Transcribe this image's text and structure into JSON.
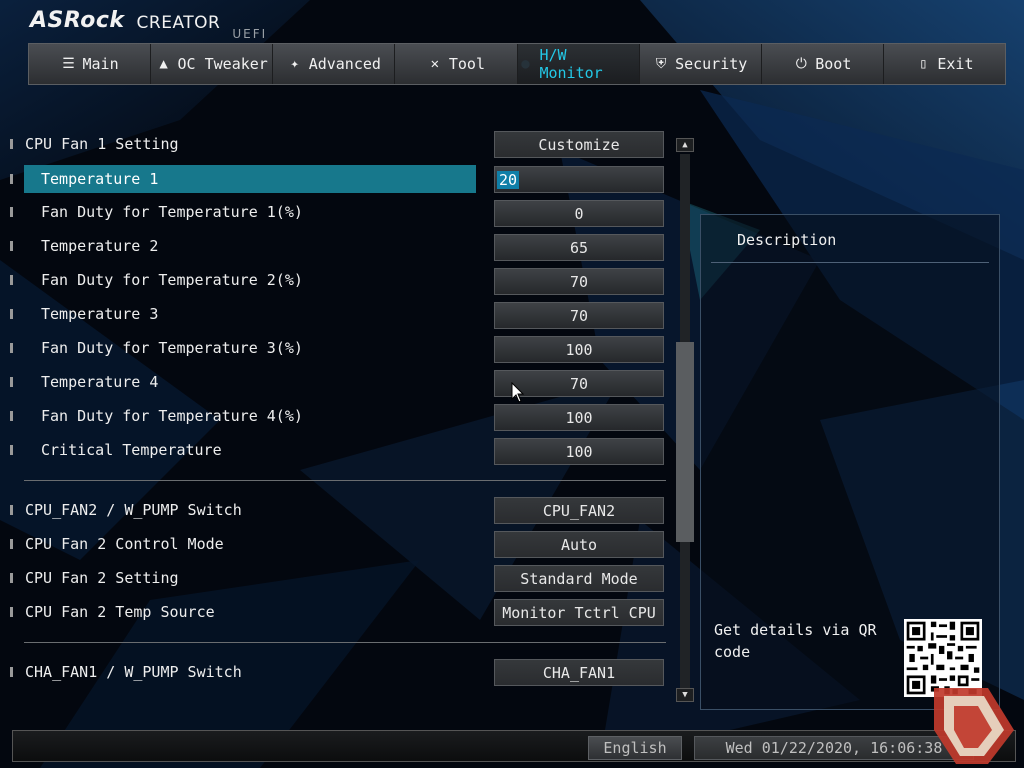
{
  "header": {
    "brand": "ASRock",
    "product": "CREATOR",
    "firmware": "UEFI"
  },
  "tabs": [
    {
      "label": "Main",
      "icon": "list-icon",
      "active": false
    },
    {
      "label": "OC Tweaker",
      "icon": "rocket-icon",
      "active": false
    },
    {
      "label": "Advanced",
      "icon": "star-icon",
      "active": false
    },
    {
      "label": "Tool",
      "icon": "tools-icon",
      "active": false
    },
    {
      "label": "H/W Monitor",
      "icon": "monitor-icon",
      "active": true
    },
    {
      "label": "Security",
      "icon": "shield-icon",
      "active": false
    },
    {
      "label": "Boot",
      "icon": "power-icon",
      "active": false
    },
    {
      "label": "Exit",
      "icon": "exit-door-icon",
      "active": false
    }
  ],
  "settings": [
    {
      "label": "CPU Fan 1 Setting",
      "value": "Customize"
    },
    {
      "label": "Temperature 1",
      "value": "20"
    },
    {
      "label": "Fan Duty for Temperature 1(%)",
      "value": "0"
    },
    {
      "label": "Temperature 2",
      "value": "65"
    },
    {
      "label": "Fan Duty for Temperature 2(%)",
      "value": "70"
    },
    {
      "label": "Temperature 3",
      "value": "70"
    },
    {
      "label": "Fan Duty for Temperature 3(%)",
      "value": "100"
    },
    {
      "label": "Temperature 4",
      "value": "70"
    },
    {
      "label": "Fan Duty for Temperature 4(%)",
      "value": "100"
    },
    {
      "label": "Critical Temperature",
      "value": "100"
    },
    {
      "label": "CPU_FAN2 / W_PUMP Switch",
      "value": "CPU_FAN2"
    },
    {
      "label": "CPU Fan 2 Control Mode",
      "value": "Auto"
    },
    {
      "label": "CPU Fan 2 Setting",
      "value": "Standard Mode"
    },
    {
      "label": "CPU Fan 2 Temp Source",
      "value": "Monitor Tctrl CPU"
    },
    {
      "label": "CHA_FAN1 / W_PUMP Switch",
      "value": "CHA_FAN1"
    }
  ],
  "description": {
    "title": "Description",
    "qr_text": "Get details via QR code"
  },
  "footer": {
    "language": "English",
    "datetime": "Wed 01/22/2020, 16:06:38"
  },
  "colors": {
    "accent": "#23c8e6",
    "selection": "#17788c"
  }
}
